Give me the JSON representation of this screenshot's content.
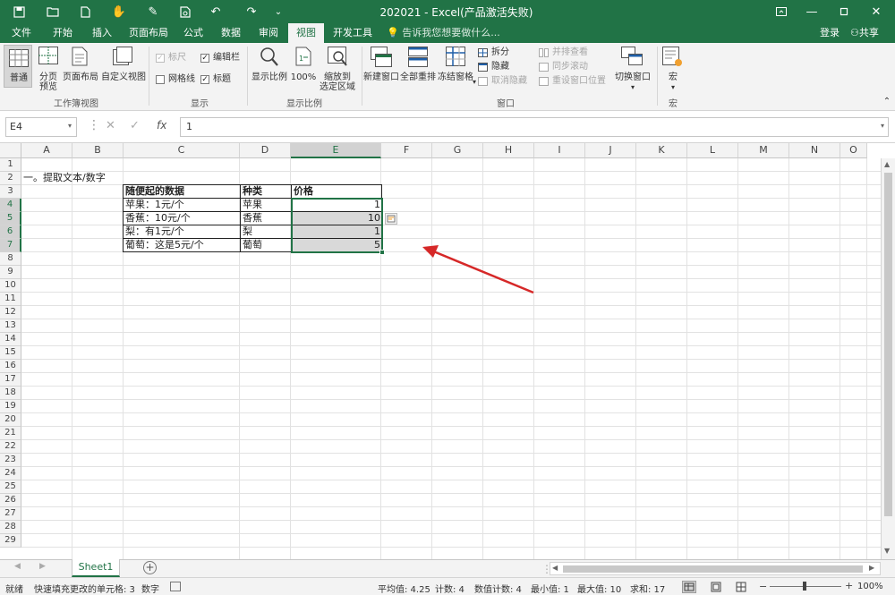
{
  "window": {
    "title": "202021 - Excel(产品激活失败)",
    "login": "登录",
    "share": "共享"
  },
  "tabs": [
    "文件",
    "开始",
    "插入",
    "页面布局",
    "公式",
    "数据",
    "审阅",
    "视图",
    "开发工具"
  ],
  "active_tab": "视图",
  "tell_me": "告诉我您想要做什么...",
  "ribbon": {
    "normal": "普通",
    "page_break_1": "分页",
    "page_break_2": "预览",
    "page_layout": "页面布局",
    "custom_view": "自定义视图",
    "group_workbook_views": "工作簿视图",
    "ruler": "标尺",
    "formula_bar": "编辑栏",
    "gridlines": "网格线",
    "headings": "标题",
    "group_show": "显示",
    "zoom": "显示比例",
    "zoom_100": "100%",
    "zoom_sel_1": "缩放到",
    "zoom_sel_2": "选定区域",
    "group_zoom": "显示比例",
    "new_window": "新建窗口",
    "arrange_all": "全部重排",
    "freeze": "冻结窗格",
    "split": "拆分",
    "hide": "隐藏",
    "unhide": "取消隐藏",
    "side_by_side": "并排查看",
    "sync_scroll": "同步滚动",
    "reset_pos": "重设窗口位置",
    "group_window": "窗口",
    "switch_windows": "切换窗口",
    "macros": "宏",
    "group_macros": "宏"
  },
  "formula_bar": {
    "name_box": "E4",
    "value": "1"
  },
  "columns": [
    "A",
    "B",
    "C",
    "D",
    "E",
    "F",
    "G",
    "H",
    "I",
    "J",
    "K",
    "L",
    "M",
    "N",
    "O"
  ],
  "rows": [
    "1",
    "2",
    "3",
    "4",
    "5",
    "6",
    "7",
    "8",
    "9",
    "10",
    "11",
    "12",
    "13",
    "14",
    "15",
    "16",
    "17",
    "18",
    "19",
    "20",
    "21",
    "22",
    "23",
    "24",
    "25",
    "26",
    "27",
    "28",
    "29"
  ],
  "sheet": {
    "a2": "一。提取文本/数字",
    "header": [
      "随便起的数据",
      "种类",
      "价格"
    ],
    "data": [
      {
        "text": "苹果：1元/个",
        "kind": "苹果",
        "price": "1"
      },
      {
        "text": "香蕉：10元/个",
        "kind": "香蕉",
        "price": "10"
      },
      {
        "text": "梨：有1元/个",
        "kind": "梨",
        "price": "1"
      },
      {
        "text": "葡萄：这是5元/个",
        "kind": "葡萄",
        "price": "5"
      }
    ]
  },
  "sheet_tab": "Sheet1",
  "status": {
    "ready": "就绪",
    "flash_fill": "快速填充更改的单元格: 3",
    "mode": "数字",
    "average": "平均值: 4.25",
    "count": "计数: 4",
    "numcount": "数值计数: 4",
    "min": "最小值: 1",
    "max": "最大值: 10",
    "sum": "求和: 17",
    "zoom": "100%"
  },
  "colors": {
    "accent": "#217346",
    "arrow": "#d62828"
  }
}
